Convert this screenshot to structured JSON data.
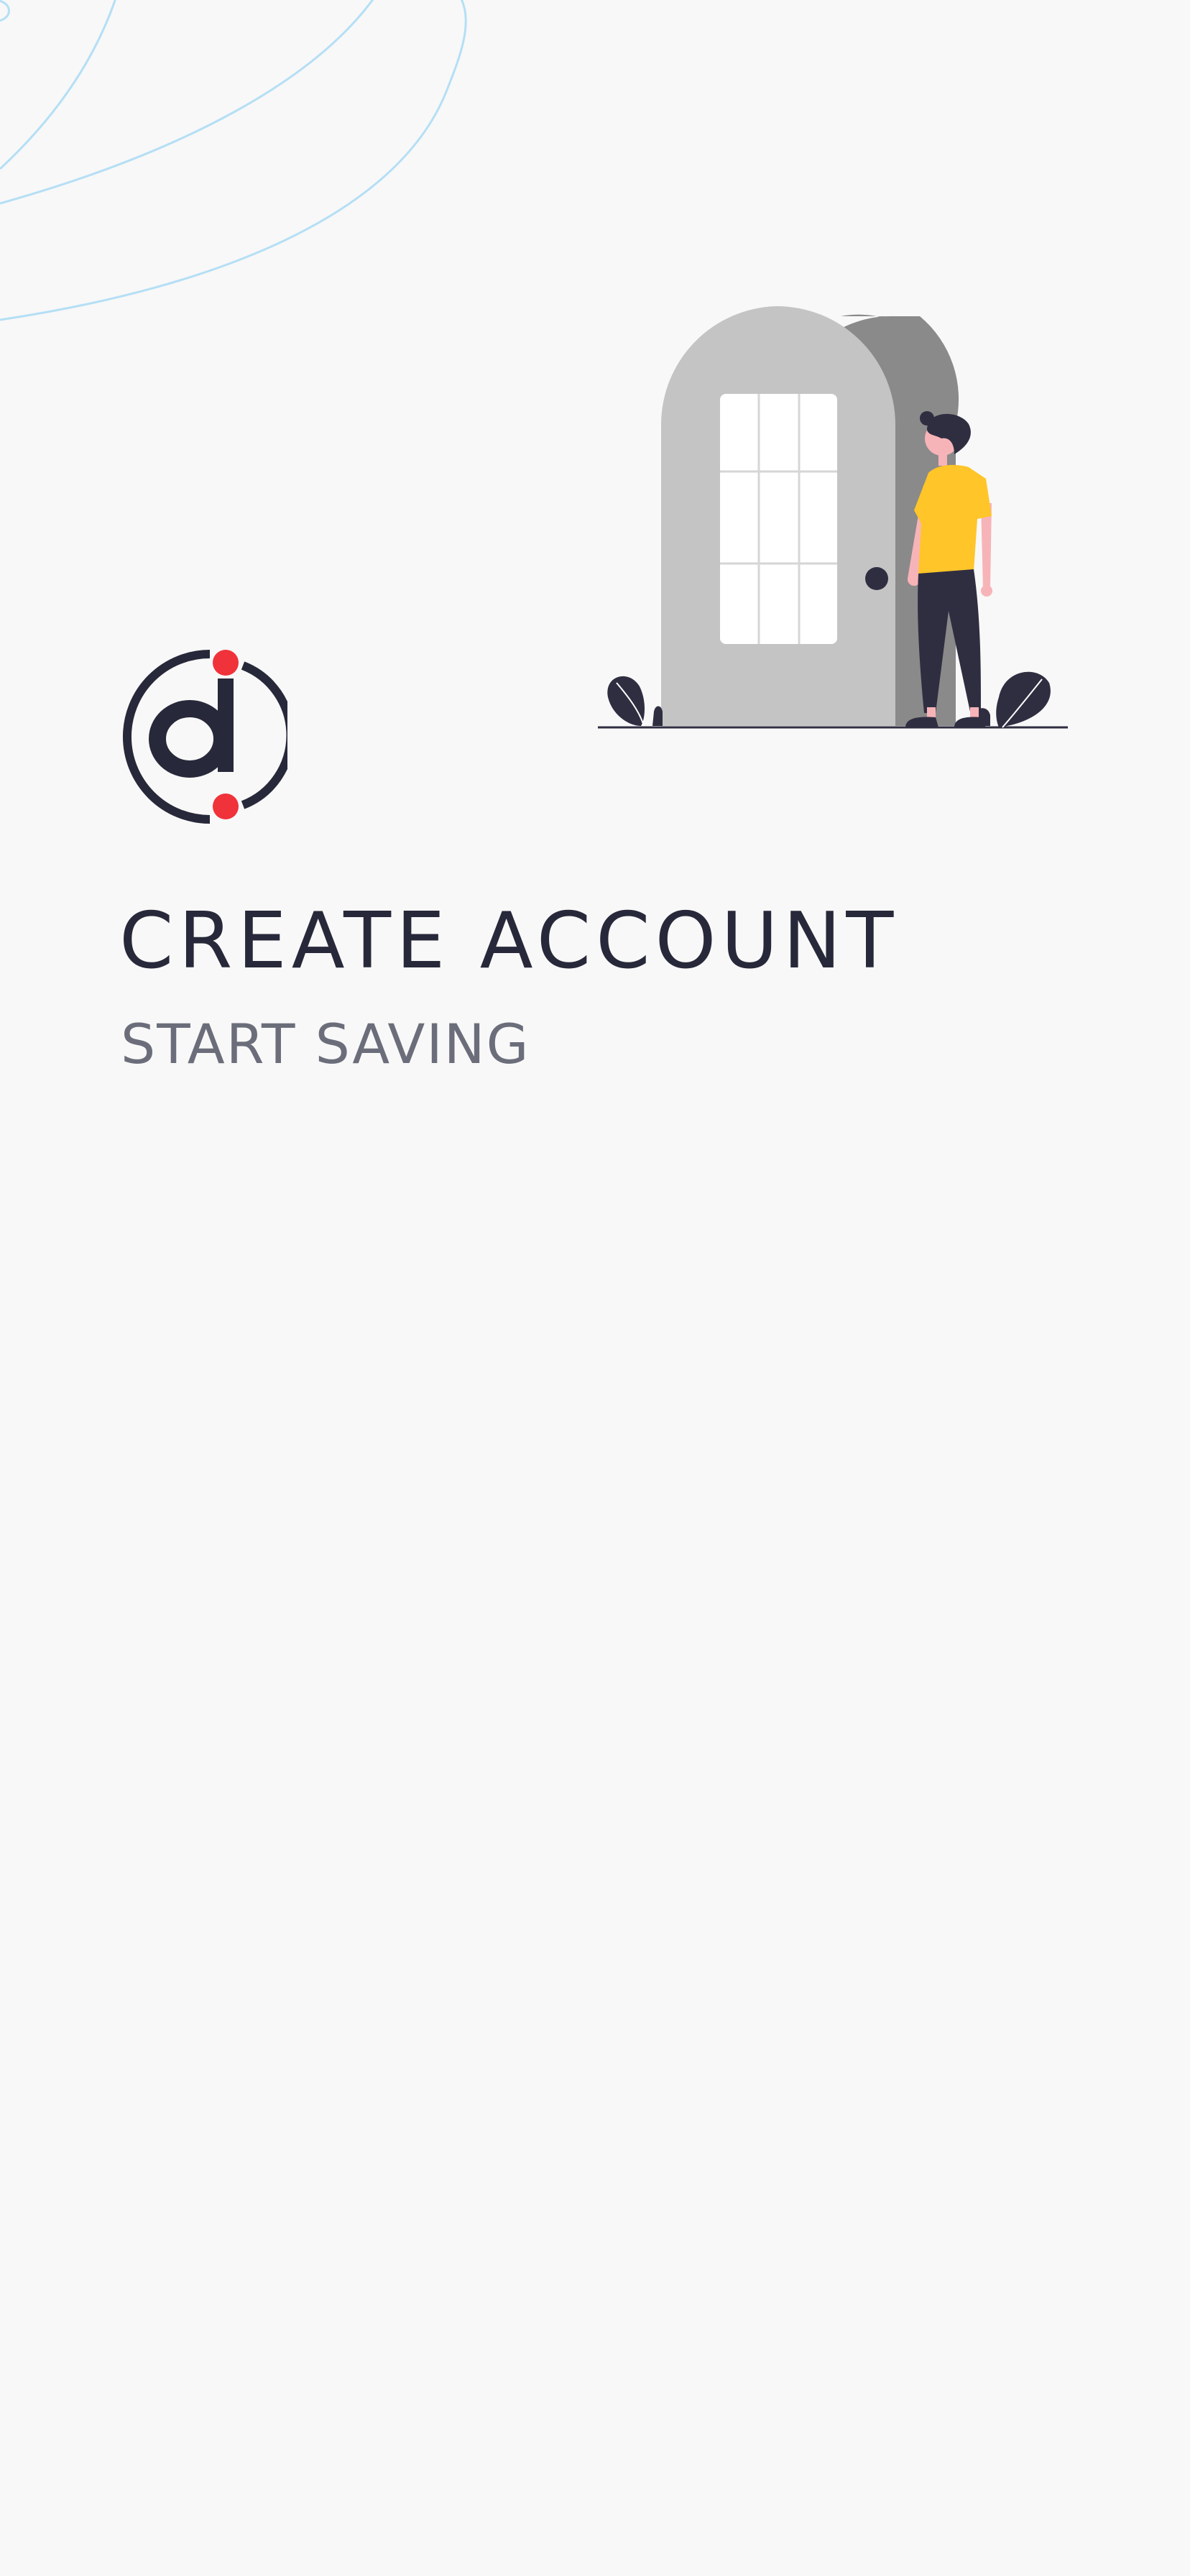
{
  "header": {
    "title": "CREATE ACCOUNT",
    "subtitle": "START SAVING"
  },
  "logo": {
    "icon": "d-logo-icon",
    "primary_color": "#27293a",
    "accent_color": "#f0323a"
  },
  "illustration": {
    "icon": "person-at-door-icon",
    "door_color": "#c4c4c4",
    "door_shadow_color": "#8a8a8a",
    "shirt_color": "#ffc529",
    "skin_color": "#f7b4b8",
    "dark_color": "#2f2e41"
  },
  "decoration": {
    "line_color": "#b5dff5"
  }
}
